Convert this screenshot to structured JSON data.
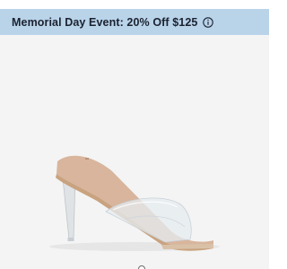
{
  "promo_banner": {
    "label": "Memorial Day Event: 20% Off $125",
    "info_icon": "info-circle-icon",
    "background_color": "#b9d3e9",
    "text_color": "#1b2230"
  },
  "product_image": {
    "subject": "clear-vinyl-strap-stiletto-mule",
    "background_color": "#f4f4f4",
    "colors": {
      "sole": "#d8b59c",
      "heel": "#dfe3e6",
      "strap": "#e6ecf0",
      "trim": "#c9a27f"
    }
  },
  "carousel": {
    "indicator_icon": "carousel-dot-icon"
  }
}
